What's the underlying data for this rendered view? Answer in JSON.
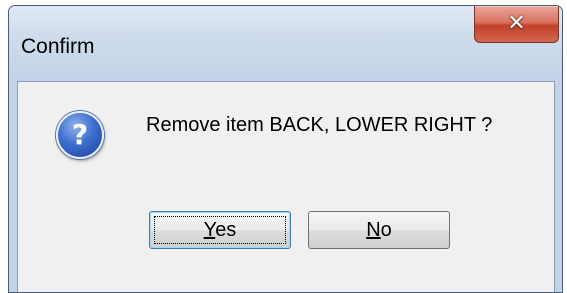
{
  "dialog": {
    "title": "Confirm",
    "message": "Remove item BACK, LOWER RIGHT ?",
    "icon": "question-icon",
    "question_glyph": "?",
    "close_glyph": "✕",
    "buttons": {
      "yes": {
        "mnemonic": "Y",
        "rest": "es"
      },
      "no": {
        "mnemonic": "N",
        "rest": "o"
      }
    },
    "default_button": "yes"
  },
  "colors": {
    "close_button": "#d9735f",
    "question_icon": "#3d6fcf",
    "dialog_background": "#f0f0f0",
    "frame": "#c3d3e6"
  }
}
